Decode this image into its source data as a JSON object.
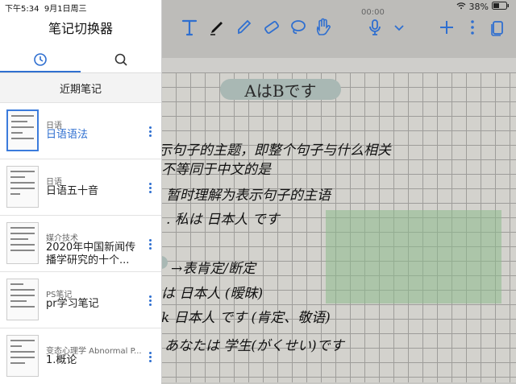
{
  "status": {
    "time": "下午5:34",
    "date": "9月1日周三",
    "battery": "38%"
  },
  "sidebar": {
    "title": "笔记切换器",
    "section": "近期笔记",
    "notes": [
      {
        "category": "日语",
        "title": "日语语法",
        "selected": true
      },
      {
        "category": "日语",
        "title": "日语五十音",
        "selected": false
      },
      {
        "category": "媒介技术",
        "title": "2020年中国新闻传播学研究的十个...",
        "selected": false
      },
      {
        "category": "PS笔记",
        "title": "pr学习笔记",
        "selected": false
      },
      {
        "category": "变态心理学 Abnormal P...",
        "title": "1.概论",
        "selected": false
      }
    ]
  },
  "toolbar": {
    "recording_time": "00:00",
    "icons": [
      "text-tool-icon",
      "pen-tool-icon",
      "highlighter-tool-icon",
      "eraser-tool-icon",
      "lasso-tool-icon",
      "hand-tool-icon",
      "microphone-icon",
      "chevron-down-icon",
      "add-icon",
      "more-vertical-icon",
      "pages-icon"
    ]
  },
  "canvas": {
    "title": "AはBです",
    "lines": [
      "示句子的主题，即整个句子与什么相关",
      "不等同于中文的是",
      "暂时理解为表示句子的主语",
      ". 私は 日本人 です",
      "→表肯定/断定",
      "は 日本人 (暧昧)",
      "k 日本人 です (肯定、敬语)",
      "あなたは 学生(がくせい)です"
    ]
  },
  "colors": {
    "accent": "#2f6fd0",
    "pill": "#a9b8b4",
    "highlight": "#8cb98c"
  }
}
